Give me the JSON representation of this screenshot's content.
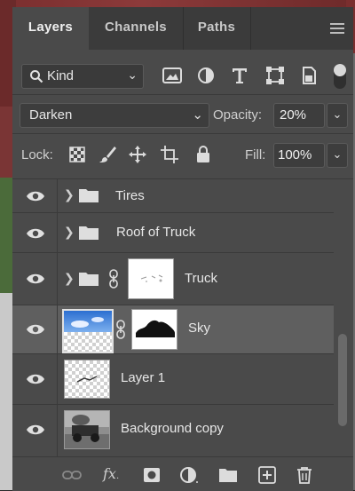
{
  "tabs": [
    {
      "label": "Layers",
      "active": true
    },
    {
      "label": "Channels",
      "active": false
    },
    {
      "label": "Paths",
      "active": false
    }
  ],
  "filter": {
    "kind_label": "Kind"
  },
  "blend": {
    "mode": "Darken",
    "opacity_label": "Opacity:",
    "opacity_value": "20%"
  },
  "lock": {
    "label": "Lock:",
    "fill_label": "Fill:",
    "fill_value": "100%"
  },
  "layers": [
    {
      "name": "Tires",
      "type": "group",
      "visible": true
    },
    {
      "name": "Roof of Truck",
      "type": "group",
      "visible": true
    },
    {
      "name": "Truck",
      "type": "group-with-mask",
      "visible": true
    },
    {
      "name": "Sky",
      "type": "layer-with-mask",
      "visible": true,
      "selected": true
    },
    {
      "name": "Layer 1",
      "type": "layer",
      "visible": true
    },
    {
      "name": "Background copy",
      "type": "layer",
      "visible": true
    }
  ],
  "colors": {
    "panel_bg": "#4a4a4a",
    "tab_bar": "#3b3b3b",
    "selected_row": "#5f5f5f"
  }
}
